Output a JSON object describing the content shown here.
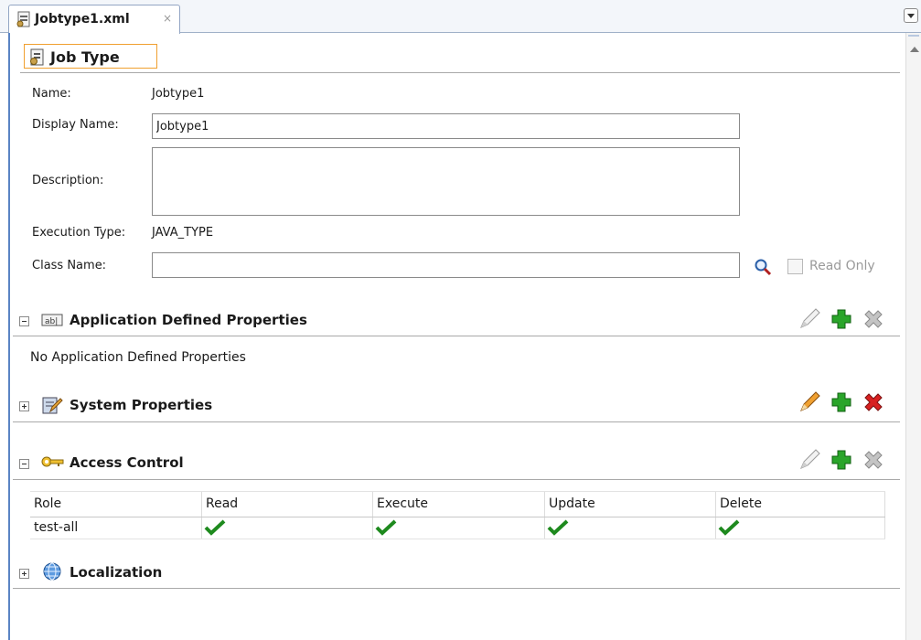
{
  "tab": {
    "title": "Jobtype1.xml",
    "close": "×"
  },
  "header": {
    "title": "Job Type"
  },
  "form": {
    "name_label": "Name:",
    "name_value": "Jobtype1",
    "display_name_label": "Display Name:",
    "display_name_value": "Jobtype1",
    "description_label": "Description:",
    "description_value": "",
    "execution_type_label": "Execution Type:",
    "execution_type_value": "JAVA_TYPE",
    "class_name_label": "Class Name:",
    "class_name_value": "",
    "read_only_label": "Read Only",
    "read_only_checked": false
  },
  "sections": {
    "app_props": {
      "title": "Application Defined Properties",
      "empty_text": "No Application Defined Properties",
      "expanded": true,
      "icon": "ab-field-icon"
    },
    "system_props": {
      "title": "System Properties",
      "expanded": false,
      "icon": "notepad-pencil-icon"
    },
    "access_control": {
      "title": "Access Control",
      "expanded": true,
      "icon": "key-icon"
    },
    "localization": {
      "title": "Localization",
      "expanded": false,
      "icon": "globe-icon"
    }
  },
  "access_table": {
    "columns": [
      "Role",
      "Read",
      "Execute",
      "Update",
      "Delete"
    ],
    "rows": [
      {
        "role": "test-all",
        "read": true,
        "execute": true,
        "update": true,
        "delete": true
      }
    ]
  },
  "colors": {
    "accent_orange": "#f0a030",
    "add_green": "#2aa52a",
    "delete_red": "#d82020",
    "disabled_gray": "#9a9a9a",
    "tab_border": "#93a6c4"
  }
}
